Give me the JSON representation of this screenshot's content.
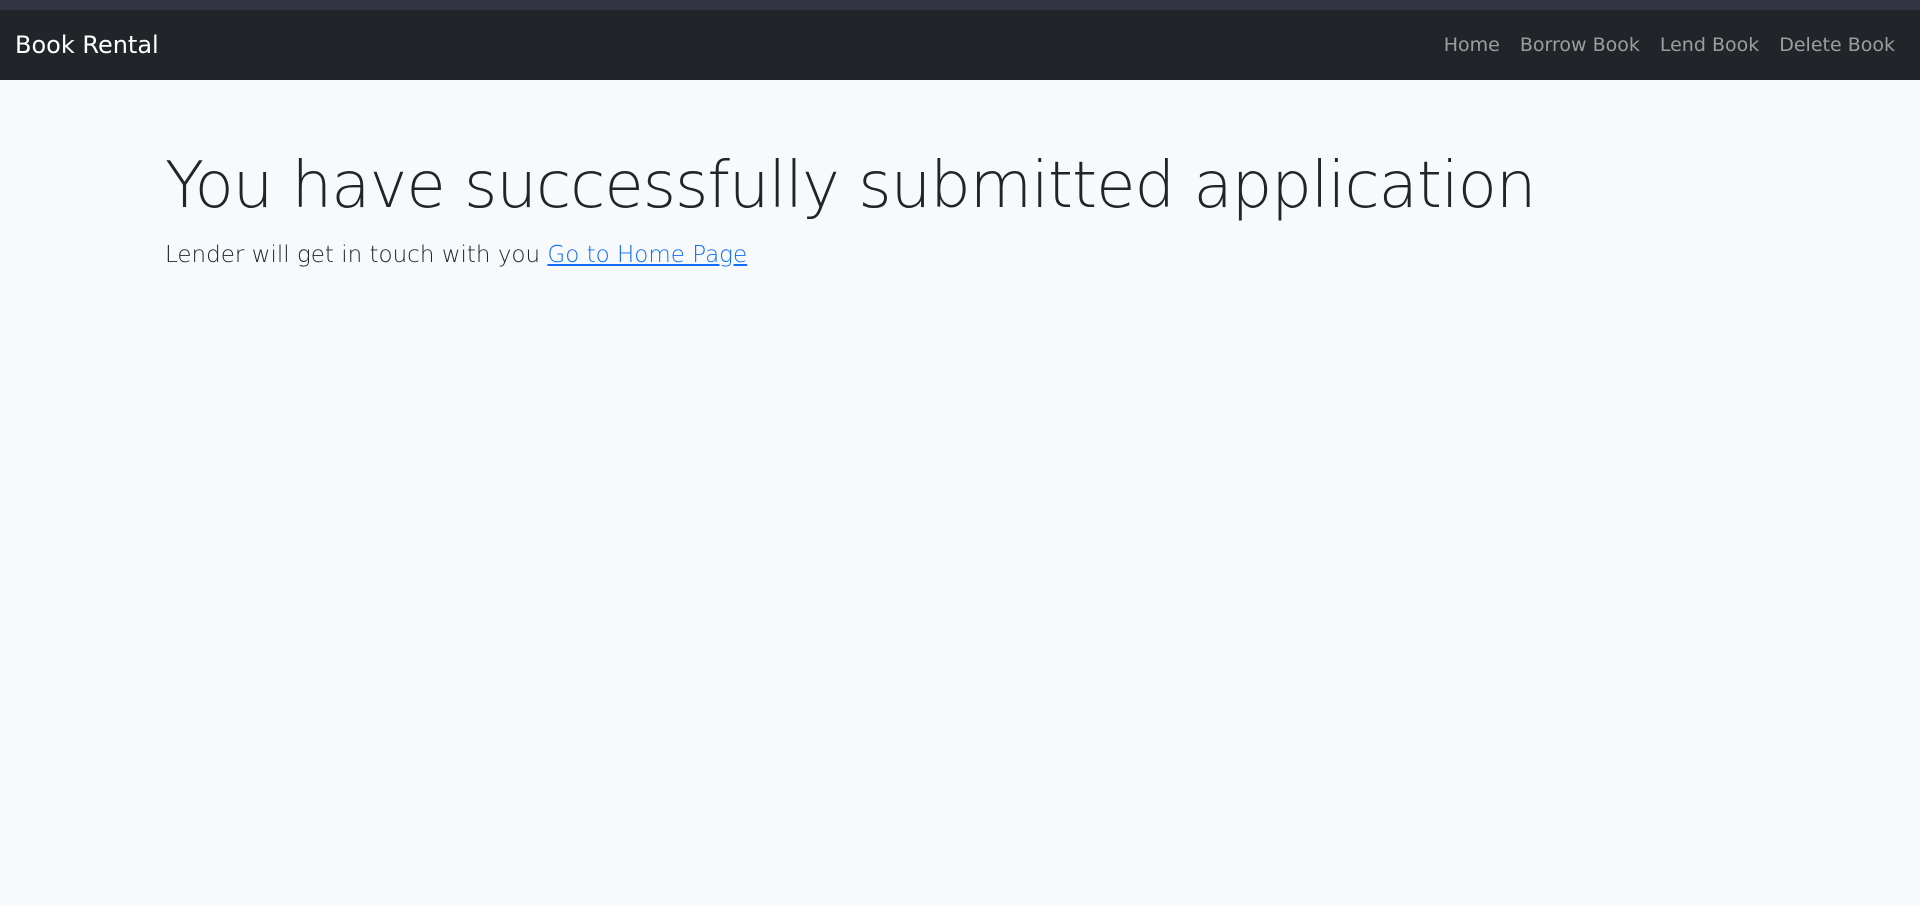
{
  "navbar": {
    "brand": "Book Rental",
    "links": [
      {
        "label": "Home"
      },
      {
        "label": "Borrow Book"
      },
      {
        "label": "Lend Book"
      },
      {
        "label": "Delete Book"
      }
    ]
  },
  "main": {
    "title": "You have successfully submitted application",
    "message": "Lender will get in touch with you",
    "home_link_label": "Go to Home Page"
  },
  "colors": {
    "navbar_bg": "#212529",
    "page_bg": "#f8f9fa",
    "link": "#0d6efd"
  }
}
